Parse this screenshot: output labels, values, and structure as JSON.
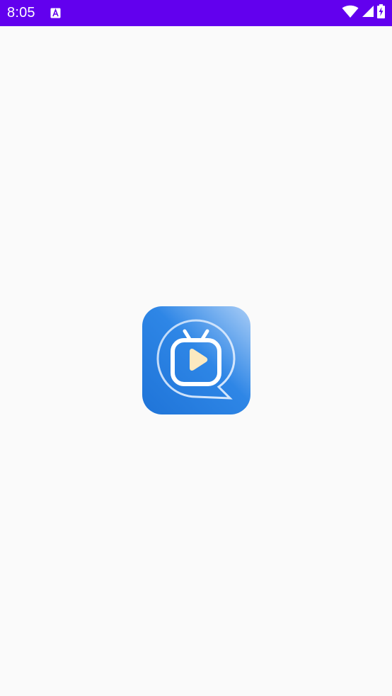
{
  "status_bar": {
    "time": "8:05",
    "background": "#6200ee",
    "notification_icon": "accessibility-app-icon",
    "icons": [
      "wifi-icon",
      "signal-icon",
      "battery-charging-icon"
    ]
  },
  "splash": {
    "logo_icon": "tv-chat-app-logo-icon",
    "logo_gradient": [
      "#2a7fe0",
      "#9ac4f5"
    ],
    "play_color": "#fbe9c0"
  },
  "background": "#fafafa"
}
